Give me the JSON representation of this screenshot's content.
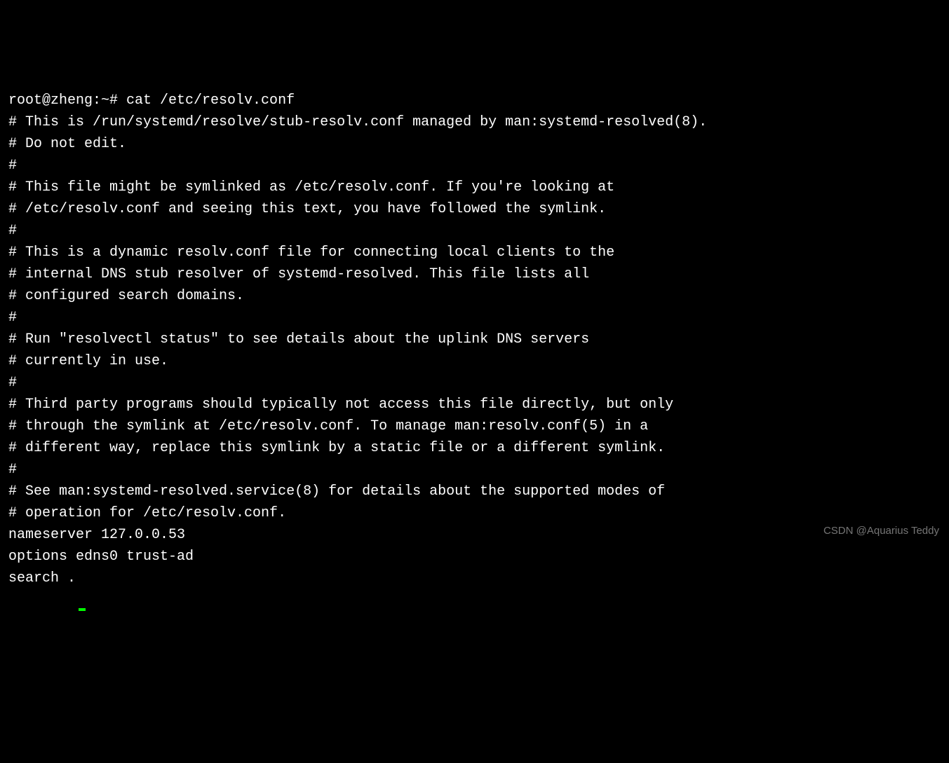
{
  "terminal": {
    "lines": [
      "root@zheng:~# cat /etc/resolv.conf",
      "# This is /run/systemd/resolve/stub-resolv.conf managed by man:systemd-resolved(8).",
      "# Do not edit.",
      "#",
      "# This file might be symlinked as /etc/resolv.conf. If you're looking at",
      "# /etc/resolv.conf and seeing this text, you have followed the symlink.",
      "#",
      "# This is a dynamic resolv.conf file for connecting local clients to the",
      "# internal DNS stub resolver of systemd-resolved. This file lists all",
      "# configured search domains.",
      "#",
      "# Run \"resolvectl status\" to see details about the uplink DNS servers",
      "# currently in use.",
      "#",
      "# Third party programs should typically not access this file directly, but only",
      "# through the symlink at /etc/resolv.conf. To manage man:resolv.conf(5) in a",
      "# different way, replace this symlink by a static file or a different symlink.",
      "#",
      "# See man:systemd-resolved.service(8) for details about the supported modes of",
      "# operation for /etc/resolv.conf.",
      "",
      "nameserver 127.0.0.53",
      "options edns0 trust-ad",
      "search ."
    ]
  },
  "watermark": "CSDN @Aquarius Teddy"
}
